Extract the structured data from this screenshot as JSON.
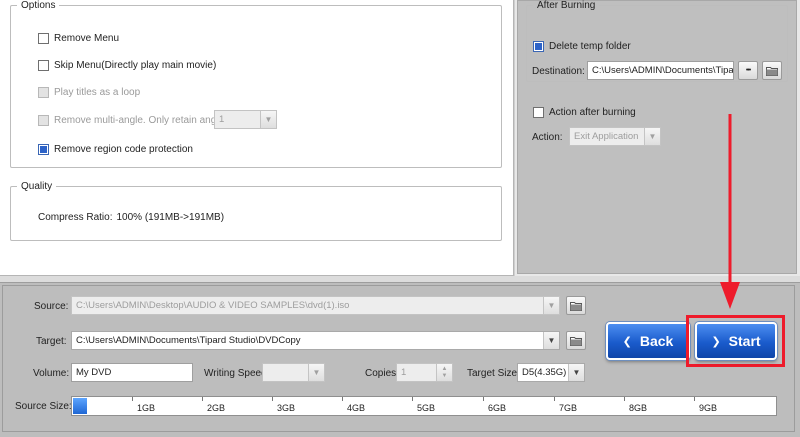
{
  "options": {
    "title": "Options",
    "items": [
      {
        "label": "Remove Menu",
        "checked": false,
        "disabled": false
      },
      {
        "label": "Skip Menu(Directly play main movie)",
        "checked": false,
        "disabled": false
      },
      {
        "label": "Play titles as a loop",
        "checked": false,
        "disabled": true
      },
      {
        "label": "Remove multi-angle. Only retain angle",
        "checked": false,
        "disabled": true
      },
      {
        "label": "Remove region code protection",
        "checked": true,
        "disabled": false
      }
    ],
    "angle_value": "1"
  },
  "quality": {
    "title": "Quality",
    "compress_label": "Compress Ratio:",
    "compress_value": "100%  (191MB->191MB)"
  },
  "after_burning": {
    "title": "After Burning",
    "delete_temp_label": "Delete temp folder",
    "delete_temp_checked": true,
    "destination_label": "Destination:",
    "destination_value": "C:\\Users\\ADMIN\\Documents\\Tipard",
    "more_button": "•••",
    "action_after_label": "Action after burning",
    "action_after_checked": false,
    "action_label": "Action:",
    "action_value": "Exit Application"
  },
  "bottom": {
    "source_label": "Source:",
    "source_value": "C:\\Users\\ADMIN\\Desktop\\AUDIO & VIDEO SAMPLES\\dvd(1).iso",
    "target_label": "Target:",
    "target_value": "C:\\Users\\ADMIN\\Documents\\Tipard Studio\\DVDCopy",
    "volume_label": "Volume:",
    "volume_value": "My DVD",
    "writing_speed_label": "Writing Speed:",
    "writing_speed_value": "",
    "copies_label": "Copies:",
    "copies_value": "1",
    "target_size_label": "Target Size:",
    "target_size_value": "D5(4.35G)",
    "back_label": "Back",
    "start_label": "Start",
    "source_size_label": "Source Size:",
    "source_size_fraction": 0.0195,
    "ticks": [
      "1GB",
      "2GB",
      "3GB",
      "4GB",
      "5GB",
      "6GB",
      "7GB",
      "8GB",
      "9GB"
    ]
  },
  "colors": {
    "annotation": "#ee1b2b",
    "button_blue": "#1a5bcc",
    "checkbox_fill": "#2d63c8"
  },
  "icons": [
    "folder-icon",
    "chevron-down-icon",
    "chevron-left-icon",
    "chevron-right-icon",
    "spin-arrows-icon"
  ]
}
